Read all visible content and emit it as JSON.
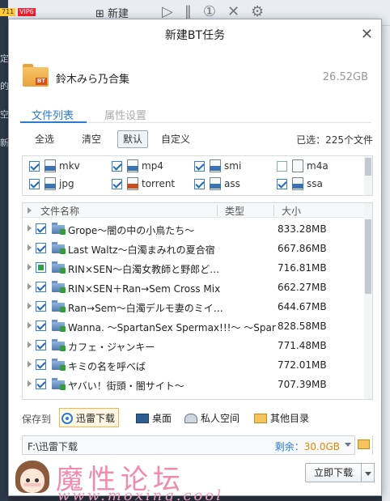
{
  "background": {
    "badge1": "711",
    "badge2": "VIP6",
    "new_label": "新建",
    "side_chars": [
      "定",
      "的",
      "空",
      "新"
    ]
  },
  "dialog": {
    "title": "新建BT任务",
    "folder_tag": "BT",
    "task_name": "鈴木みら乃合集",
    "task_size": "26.52GB",
    "tabs": [
      {
        "label": "文件列表",
        "active": true
      },
      {
        "label": "属性设置",
        "active": false
      }
    ],
    "filters": [
      {
        "label": "全选",
        "active": false
      },
      {
        "label": "清空",
        "active": false
      },
      {
        "label": "默认",
        "active": true
      },
      {
        "label": "自定义",
        "active": false
      }
    ],
    "selected_count": "已选：225个文件",
    "file_types": [
      {
        "label": "mkv",
        "checked": true,
        "icon": "video-file-icon"
      },
      {
        "label": "mp4",
        "checked": true,
        "icon": "video-file-icon"
      },
      {
        "label": "smi",
        "checked": true,
        "icon": "subtitle-file-icon"
      },
      {
        "label": "m4a",
        "checked": false,
        "icon": "blank-file-icon"
      },
      {
        "label": "jpg",
        "checked": true,
        "icon": "image-file-icon"
      },
      {
        "label": "torrent",
        "checked": true,
        "icon": "torrent-file-icon"
      },
      {
        "label": "ass",
        "checked": true,
        "icon": "subtitle-file-icon"
      },
      {
        "label": "ssa",
        "checked": true,
        "icon": "subtitle-file-icon"
      }
    ],
    "list_headers": {
      "name": "文件名称",
      "type": "类型",
      "size": "大小"
    },
    "files": [
      {
        "name": "Grope～闇の中の小鳥たち～",
        "size": "833.28MB",
        "state": "checked"
      },
      {
        "name": "Last Waltz～白濁まみれの夏合宿",
        "size": "667.86MB",
        "state": "checked"
      },
      {
        "name": "RIN×SEN～白濁女教師と野郎ど…",
        "size": "716.81MB",
        "state": "partial"
      },
      {
        "name": "RIN×SEN＋Ran→Sem Cross Mix",
        "size": "662.27MB",
        "state": "checked"
      },
      {
        "name": "Ran→Sem～白濁デルモ妻のミイ…",
        "size": "644.67MB",
        "state": "checked"
      },
      {
        "name": "Wanna. ～SpartanSex Spermax!!!～ ～SpartanSex",
        "size": "828.58MB",
        "state": "checked"
      },
      {
        "name": "カフェ・ジャンキー",
        "size": "771.48MB",
        "state": "checked"
      },
      {
        "name": "キミの名を呼べば",
        "size": "772.01MB",
        "state": "checked"
      },
      {
        "name": "ヤバい！街頭・闇サイト～",
        "size": "707.39MB",
        "state": "checked"
      }
    ],
    "save_to_label": "保存到",
    "save_targets": [
      {
        "label": "迅雷下载",
        "active": true,
        "icon": "xunlei-icon"
      },
      {
        "label": "桌面",
        "active": false,
        "icon": "desktop-icon"
      },
      {
        "label": "私人空间",
        "active": false,
        "icon": "private-space-icon"
      },
      {
        "label": "其他目录",
        "active": false,
        "icon": "folder-icon"
      }
    ],
    "path": "F:\\迅雷下载",
    "remain_label": "剩余：",
    "remain_value": "30.0GB",
    "download_label": "立即下载"
  },
  "watermark": {
    "main": "魔性论坛",
    "url": "www.moxing.cool"
  }
}
